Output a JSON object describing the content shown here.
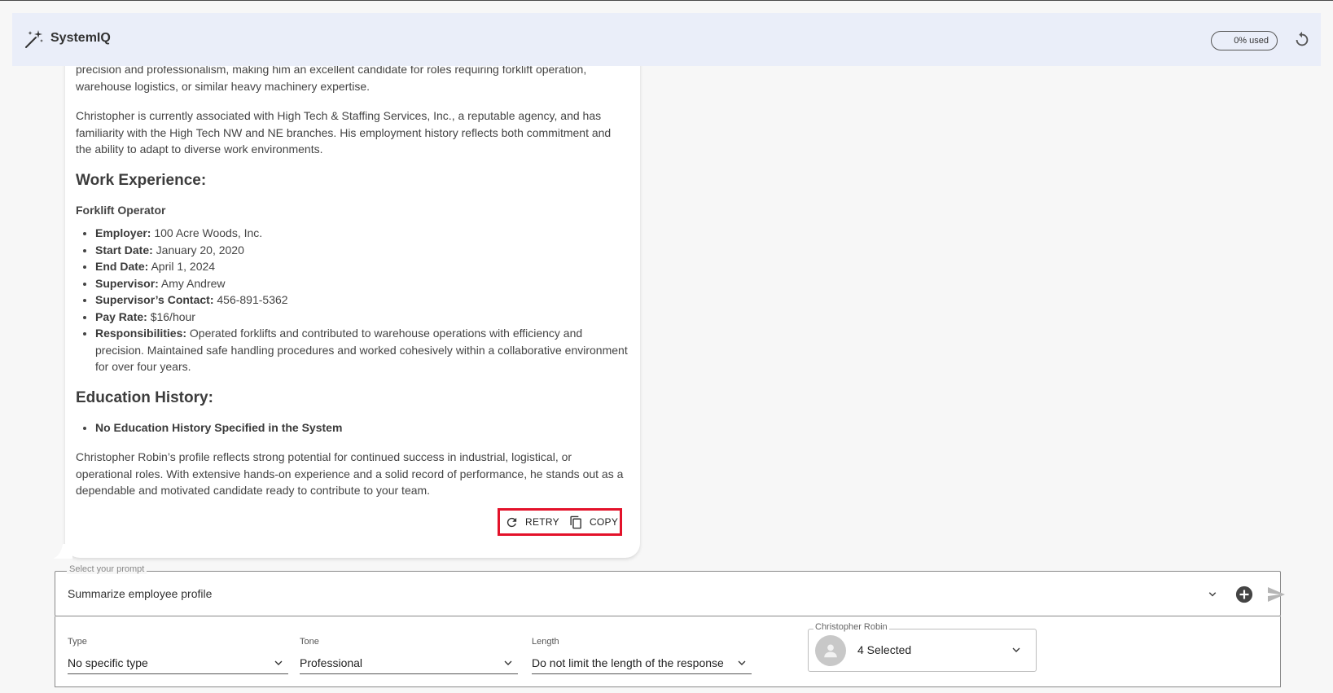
{
  "header": {
    "title": "SystemIQ",
    "usage": "0% used"
  },
  "message": {
    "intro_tail": "precision and professionalism, making him an excellent candidate for roles requiring forklift operation, warehouse logistics, or similar heavy machinery expertise.",
    "para_agency": "Christopher is currently associated with High Tech & Staffing Services, Inc., a reputable agency, and has familiarity with the High Tech NW and NE branches. His employment history reflects both commitment and the ability to adapt to diverse work environments.",
    "work_heading": "Work Experience:",
    "job_title": "Forklift Operator",
    "job_items": [
      {
        "label": "Employer:",
        "value": " 100 Acre Woods, Inc."
      },
      {
        "label": "Start Date:",
        "value": " January 20, 2020"
      },
      {
        "label": "End Date:",
        "value": " April 1, 2024"
      },
      {
        "label": "Supervisor:",
        "value": " Amy Andrew"
      },
      {
        "label": "Supervisor’s Contact:",
        "value": " 456-891-5362"
      },
      {
        "label": "Pay Rate:",
        "value": " $16/hour"
      },
      {
        "label": "Responsibilities:",
        "value": " Operated forklifts and contributed to warehouse operations with efficiency and precision. Maintained safe handling procedures and worked cohesively within a collaborative environment for over four years."
      }
    ],
    "education_heading": "Education History:",
    "education_items": [
      "No Education History Specified in the System"
    ],
    "closing": "Christopher Robin’s profile reflects strong potential for continued success in industrial, logistical, or operational roles. With extensive hands-on experience and a solid record of performance, he stands out as a dependable and motivated candidate ready to contribute to your team.",
    "retry_label": "RETRY",
    "copy_label": "COPY"
  },
  "prompt": {
    "legend": "Select your prompt",
    "value": "Summarize employee profile"
  },
  "options": {
    "type": {
      "label": "Type",
      "value": "No specific type"
    },
    "tone": {
      "label": "Tone",
      "value": "Professional"
    },
    "length": {
      "label": "Length",
      "value": "Do not limit the length of the response"
    },
    "people": {
      "legend": "Christopher Robin",
      "value": "4 Selected"
    }
  },
  "colors": {
    "header_bg": "#eaeef9",
    "highlight": "#e3122a"
  },
  "icons": [
    "magic-wand-icon",
    "refresh-icon",
    "retry-icon",
    "copy-icon",
    "chevron-down-icon",
    "add-circle-icon",
    "send-icon",
    "person-icon"
  ]
}
